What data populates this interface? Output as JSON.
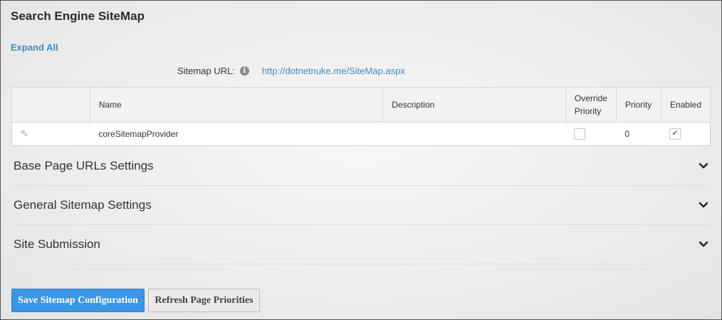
{
  "page": {
    "title": "Search Engine SiteMap",
    "expand_all": "Expand All",
    "sitemap_url_label": "Sitemap URL:",
    "info_icon": "info-icon",
    "sitemap_url": "http://dotnetnuke.me/SiteMap.aspx"
  },
  "table": {
    "headers": {
      "name": "Name",
      "description": "Description",
      "override_line1": "Override",
      "override_line2": "Priority",
      "priority": "Priority",
      "enabled": "Enabled"
    },
    "rows": [
      {
        "name": "coreSitemapProvider",
        "description": "",
        "override_priority": false,
        "priority": "0",
        "enabled": true
      }
    ]
  },
  "sections": [
    {
      "label": "Base Page URLs Settings"
    },
    {
      "label": "General Sitemap Settings"
    },
    {
      "label": "Site Submission"
    }
  ],
  "buttons": {
    "save": "Save Sitemap Configuration",
    "refresh": "Refresh Page Priorities"
  },
  "colors": {
    "link": "#3d8dbf",
    "primary_button": "#3a96e6"
  }
}
